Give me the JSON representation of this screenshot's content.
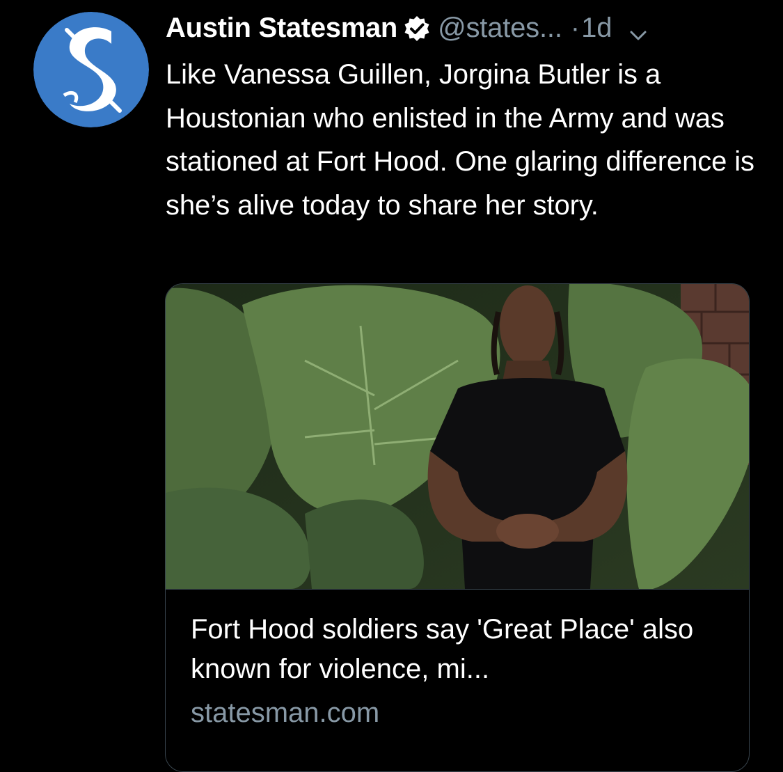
{
  "tweet": {
    "author": {
      "name": "Austin Statesman",
      "handle": "@states...",
      "avatar_icon": "statesman-s-logo-icon",
      "verified_icon": "verified-badge-icon",
      "avatar_color": "#3a7bc8"
    },
    "separator": "·",
    "time": "1d",
    "menu_icon": "chevron-down-icon",
    "text": "Like Vanessa Guillen, Jorgina Butler is a Houstonian who enlisted in the Army and was stationed at Fort Hood. One glaring difference is she’s alive today to share her story.",
    "card": {
      "image_icon": "article-photo-woman-with-leaves",
      "title": "Fort Hood soldiers say 'Great Place' also known for violence, mi...",
      "domain": "statesman.com"
    }
  },
  "colors": {
    "background": "#000000",
    "primary_text": "#ffffff",
    "secondary_text": "#8899a6",
    "border": "#38444d"
  }
}
